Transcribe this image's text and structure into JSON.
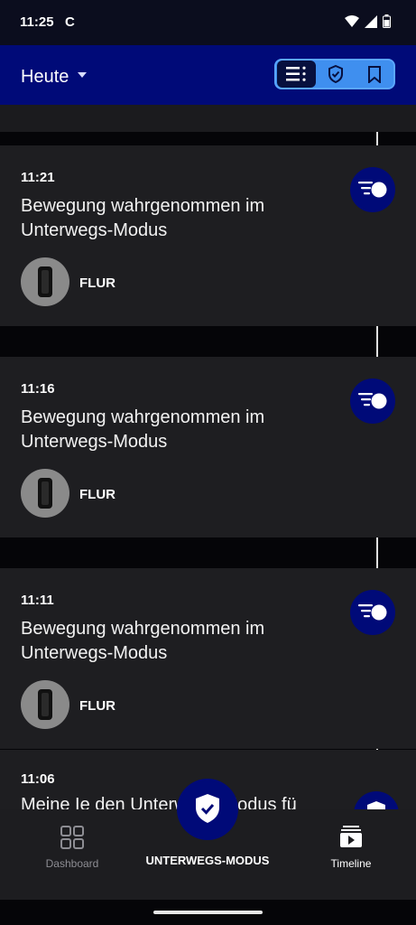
{
  "status": {
    "time": "11:25",
    "carrier_icon": "C"
  },
  "header": {
    "title": "Heute",
    "segments": [
      {
        "icon": "list-filter-icon",
        "active": true
      },
      {
        "icon": "shield-check-icon",
        "active": false
      },
      {
        "icon": "bookmark-icon",
        "active": false
      }
    ]
  },
  "events": [
    {
      "time": "11:21",
      "title": "Bewegung wahrgenommen im Unterwegs-Modus",
      "location": "FLUR"
    },
    {
      "time": "11:16",
      "title": "Bewegung wahrgenommen im Unterwegs-Modus",
      "location": "FLUR"
    },
    {
      "time": "11:11",
      "title": "Bewegung wahrgenommen im Unterwegs-Modus",
      "location": "FLUR"
    }
  ],
  "partial_event": {
    "time": "11:06",
    "title": "Meine Ie den Unterwegs-Modus fü"
  },
  "nav": {
    "dashboard": "Dashboard",
    "mode": "UNTERWEGS-MODUS",
    "timeline": "Timeline"
  },
  "colors": {
    "brand": "#000a78",
    "accent": "#3f8fef",
    "card": "#1e1e21"
  }
}
